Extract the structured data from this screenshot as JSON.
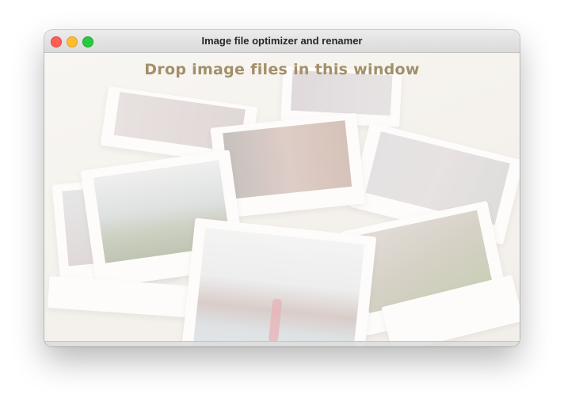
{
  "window": {
    "title": "Image file optimizer and renamer",
    "controls": {
      "close": "close",
      "minimize": "minimize",
      "zoom": "zoom"
    }
  },
  "main": {
    "drop_message": "Drop image files in this window",
    "background_image": "scattered-instant-photos"
  },
  "colors": {
    "drop_message": "#a38f69",
    "close": "#fe5f57",
    "minimize": "#febc2e",
    "zoom": "#28c840"
  }
}
